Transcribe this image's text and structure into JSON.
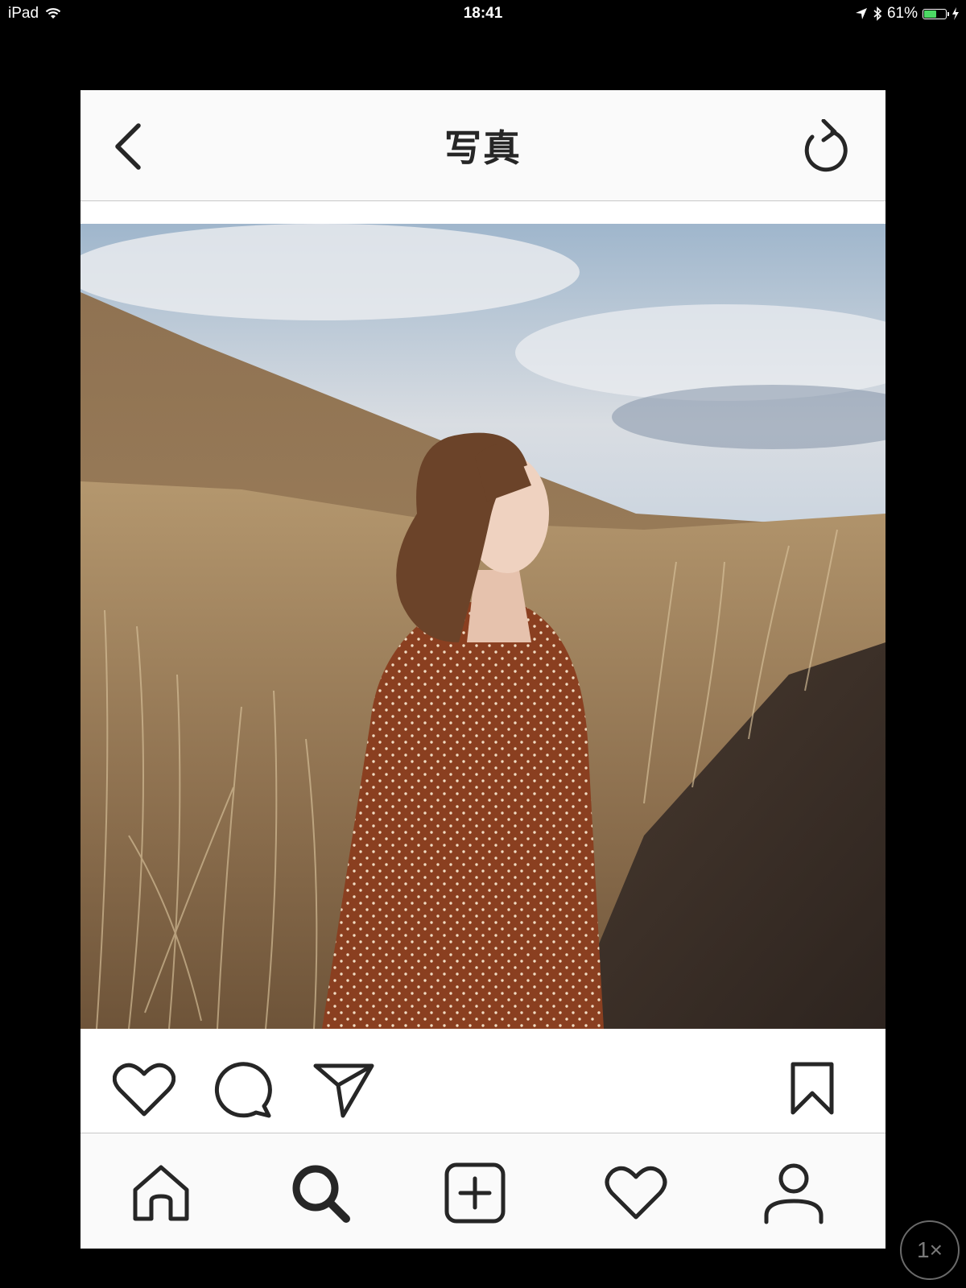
{
  "status_bar": {
    "device": "iPad",
    "time": "18:41",
    "battery_percent": "61%",
    "battery_level": 0.61
  },
  "nav_bar": {
    "title": "写真",
    "back_icon": "chevron-left-icon",
    "refresh_icon": "refresh-icon"
  },
  "actions": {
    "like_icon": "heart-outline-icon",
    "comment_icon": "speech-bubble-icon",
    "share_icon": "paper-plane-icon",
    "save_icon": "bookmark-icon"
  },
  "tab_bar": {
    "tabs": [
      {
        "icon": "home-icon"
      },
      {
        "icon": "search-icon",
        "active": true
      },
      {
        "icon": "add-square-icon"
      },
      {
        "icon": "heart-outline-icon"
      },
      {
        "icon": "profile-icon"
      }
    ]
  },
  "zoom_badge": "1×",
  "colors": {
    "icon": "#262626",
    "nav_background": "#fafafa",
    "battery_fill": "#4cd964"
  }
}
